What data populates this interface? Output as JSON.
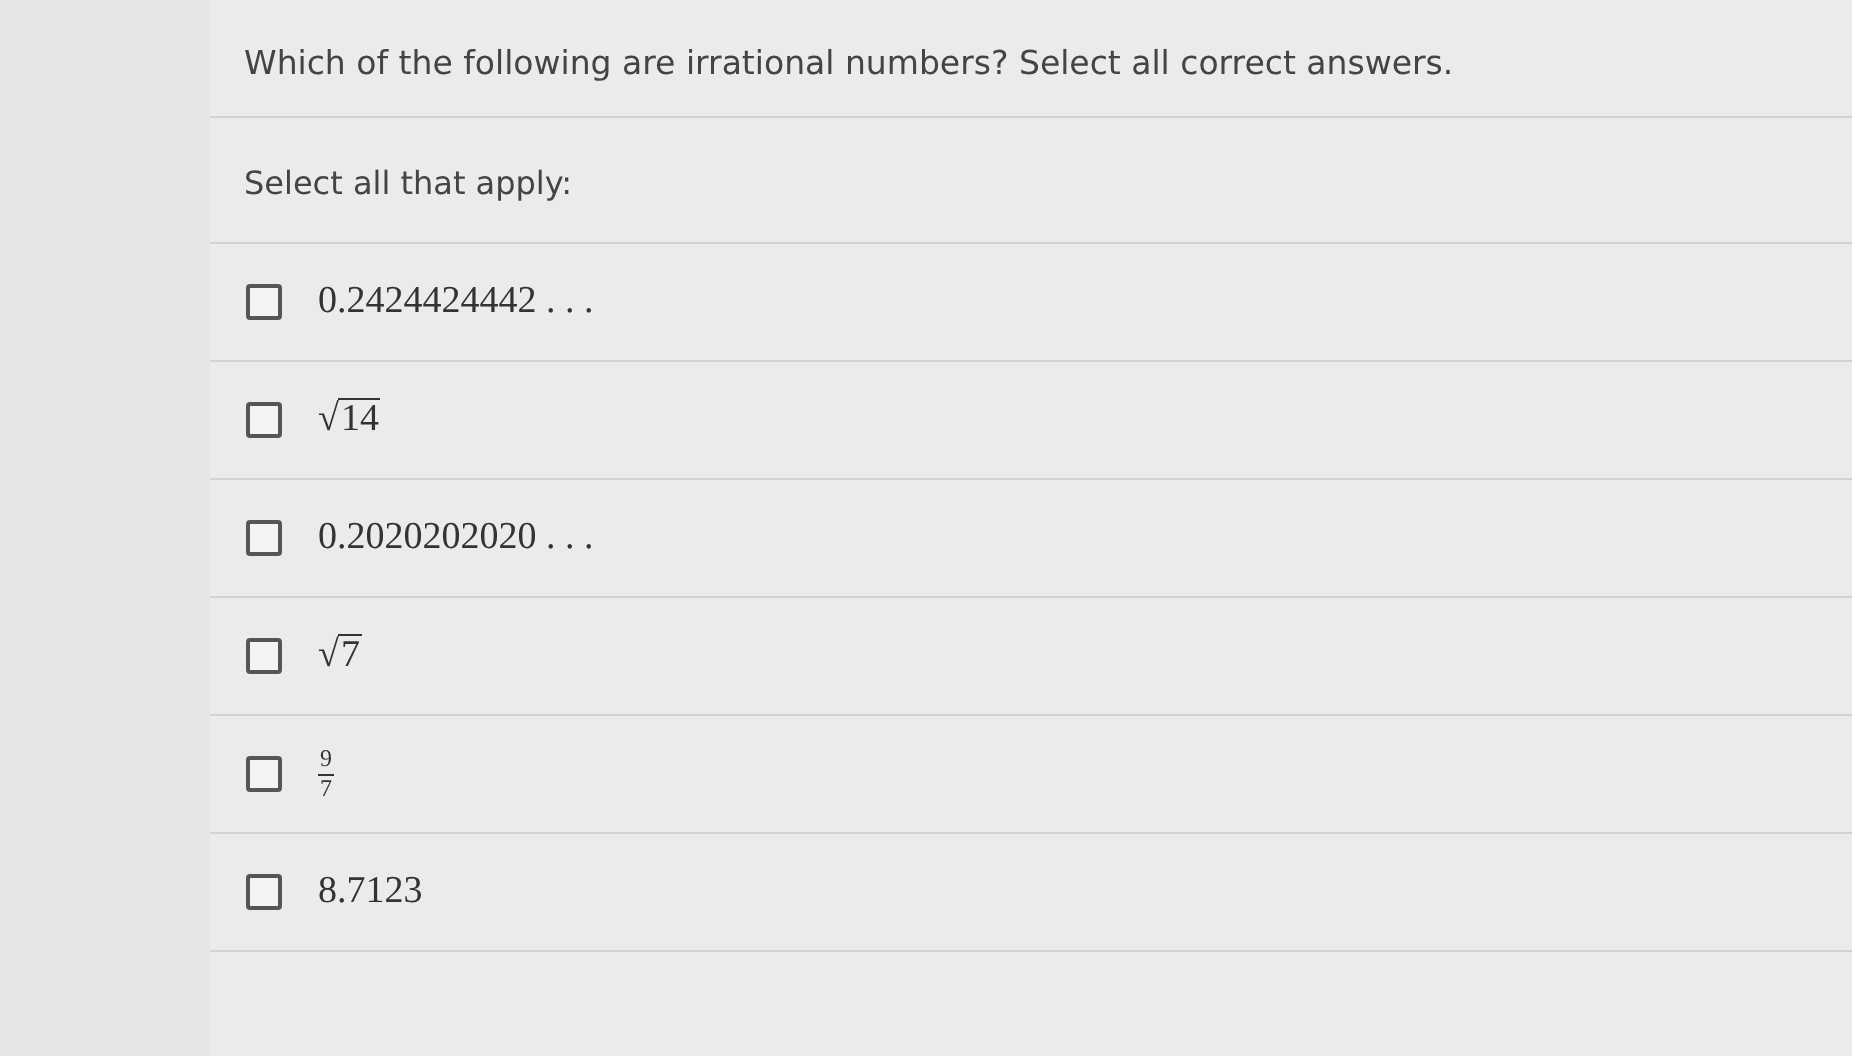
{
  "question": "Which of the following are irrational numbers? Select all correct answers.",
  "instruction": "Select all that apply:",
  "options": [
    {
      "kind": "text",
      "checked": false,
      "text": "0.2424424442 . . ."
    },
    {
      "kind": "sqrt",
      "checked": false,
      "radical": "√",
      "radicand": "14"
    },
    {
      "kind": "text",
      "checked": false,
      "text": "0.2020202020 . . ."
    },
    {
      "kind": "sqrt",
      "checked": false,
      "radical": "√",
      "radicand": "7"
    },
    {
      "kind": "fraction",
      "checked": false,
      "numerator": "9",
      "denominator": "7"
    },
    {
      "kind": "text",
      "checked": false,
      "text": "8.7123"
    }
  ]
}
